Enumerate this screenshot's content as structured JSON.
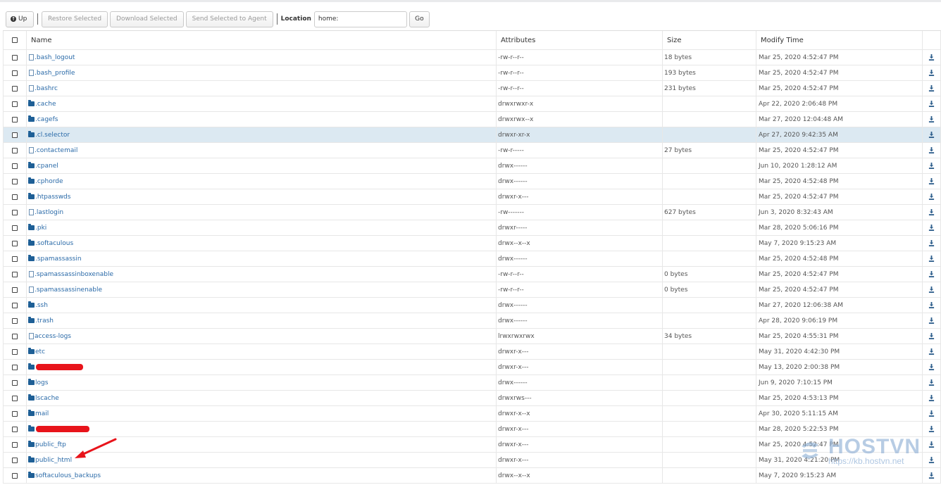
{
  "toolbar": {
    "up_label": "Up",
    "restore_label": "Restore Selected",
    "download_label": "Download Selected",
    "send_label": "Send Selected to Agent",
    "location_label": "Location",
    "location_value": "home:",
    "go_label": "Go"
  },
  "columns": {
    "name": "Name",
    "attributes": "Attributes",
    "size": "Size",
    "modify_time": "Modify Time"
  },
  "files": [
    {
      "type": "file",
      "name": ".bash_logout",
      "attr": "-rw-r--r--",
      "size": "18 bytes",
      "time": "Mar 25, 2020 4:52:47 PM"
    },
    {
      "type": "file",
      "name": ".bash_profile",
      "attr": "-rw-r--r--",
      "size": "193 bytes",
      "time": "Mar 25, 2020 4:52:47 PM"
    },
    {
      "type": "file",
      "name": ".bashrc",
      "attr": "-rw-r--r--",
      "size": "231 bytes",
      "time": "Mar 25, 2020 4:52:47 PM"
    },
    {
      "type": "folder",
      "name": ".cache",
      "attr": "drwxrwxr-x",
      "size": "",
      "time": "Apr 22, 2020 2:06:48 PM"
    },
    {
      "type": "folder",
      "name": ".cagefs",
      "attr": "drwxrwx--x",
      "size": "",
      "time": "Mar 27, 2020 12:04:48 AM"
    },
    {
      "type": "folder",
      "name": ".cl.selector",
      "attr": "drwxr-xr-x",
      "size": "",
      "time": "Apr 27, 2020 9:42:35 AM",
      "selected": true
    },
    {
      "type": "file",
      "name": ".contactemail",
      "attr": "-rw-r-----",
      "size": "27 bytes",
      "time": "Mar 25, 2020 4:52:47 PM"
    },
    {
      "type": "folder",
      "name": ".cpanel",
      "attr": "drwx------",
      "size": "",
      "time": "Jun 10, 2020 1:28:12 AM"
    },
    {
      "type": "folder",
      "name": ".cphorde",
      "attr": "drwx------",
      "size": "",
      "time": "Mar 25, 2020 4:52:48 PM"
    },
    {
      "type": "folder",
      "name": ".htpasswds",
      "attr": "drwxr-x---",
      "size": "",
      "time": "Mar 25, 2020 4:52:47 PM"
    },
    {
      "type": "file",
      "name": ".lastlogin",
      "attr": "-rw-------",
      "size": "627 bytes",
      "time": "Jun 3, 2020 8:32:43 AM"
    },
    {
      "type": "folder",
      "name": ".pki",
      "attr": "drwxr-----",
      "size": "",
      "time": "Mar 28, 2020 5:06:16 PM"
    },
    {
      "type": "folder",
      "name": ".softaculous",
      "attr": "drwx--x--x",
      "size": "",
      "time": "May 7, 2020 9:15:23 AM"
    },
    {
      "type": "folder",
      "name": ".spamassassin",
      "attr": "drwx------",
      "size": "",
      "time": "Mar 25, 2020 4:52:48 PM"
    },
    {
      "type": "file",
      "name": ".spamassassinboxenable",
      "attr": "-rw-r--r--",
      "size": "0 bytes",
      "time": "Mar 25, 2020 4:52:47 PM"
    },
    {
      "type": "file",
      "name": ".spamassassinenable",
      "attr": "-rw-r--r--",
      "size": "0 bytes",
      "time": "Mar 25, 2020 4:52:47 PM"
    },
    {
      "type": "folder",
      "name": ".ssh",
      "attr": "drwx------",
      "size": "",
      "time": "Mar 27, 2020 12:06:38 AM"
    },
    {
      "type": "folder",
      "name": ".trash",
      "attr": "drwx------",
      "size": "",
      "time": "Apr 28, 2020 9:06:19 PM"
    },
    {
      "type": "file",
      "name": "access-logs",
      "attr": "lrwxrwxrwx",
      "size": "34 bytes",
      "time": "Mar 25, 2020 4:55:31 PM"
    },
    {
      "type": "folder",
      "name": "etc",
      "attr": "drwxr-x---",
      "size": "",
      "time": "May 31, 2020 4:42:30 PM"
    },
    {
      "type": "folder",
      "name": "",
      "redacted": "short",
      "attr": "drwxr-x---",
      "size": "",
      "time": "May 13, 2020 2:00:38 PM"
    },
    {
      "type": "folder",
      "name": "logs",
      "attr": "drwx------",
      "size": "",
      "time": "Jun 9, 2020 7:10:15 PM"
    },
    {
      "type": "folder",
      "name": "lscache",
      "attr": "drwxrws---",
      "size": "",
      "time": "Mar 25, 2020 4:53:13 PM"
    },
    {
      "type": "folder",
      "name": "mail",
      "attr": "drwxr-x--x",
      "size": "",
      "time": "Apr 30, 2020 5:11:15 AM"
    },
    {
      "type": "folder",
      "name": "",
      "redacted": "long",
      "attr": "drwxr-x---",
      "size": "",
      "time": "Mar 28, 2020 5:22:53 PM"
    },
    {
      "type": "folder",
      "name": "public_ftp",
      "attr": "drwxr-x---",
      "size": "",
      "time": "Mar 25, 2020 4:52:47 PM"
    },
    {
      "type": "folder",
      "name": "public_html",
      "attr": "drwxr-x---",
      "size": "",
      "time": "May 31, 2020 4:21:20 PM"
    },
    {
      "type": "folder",
      "name": "softaculous_backups",
      "attr": "drwx--x--x",
      "size": "",
      "time": "May 7, 2020 9:15:23 AM"
    }
  ],
  "watermark": {
    "brand": "HOSTVN",
    "url": "https://kb.hostvn.net"
  },
  "colors": {
    "link": "#2a6aa8",
    "selected_row": "#dce9f2",
    "annotation_arrow": "#e8141b"
  }
}
